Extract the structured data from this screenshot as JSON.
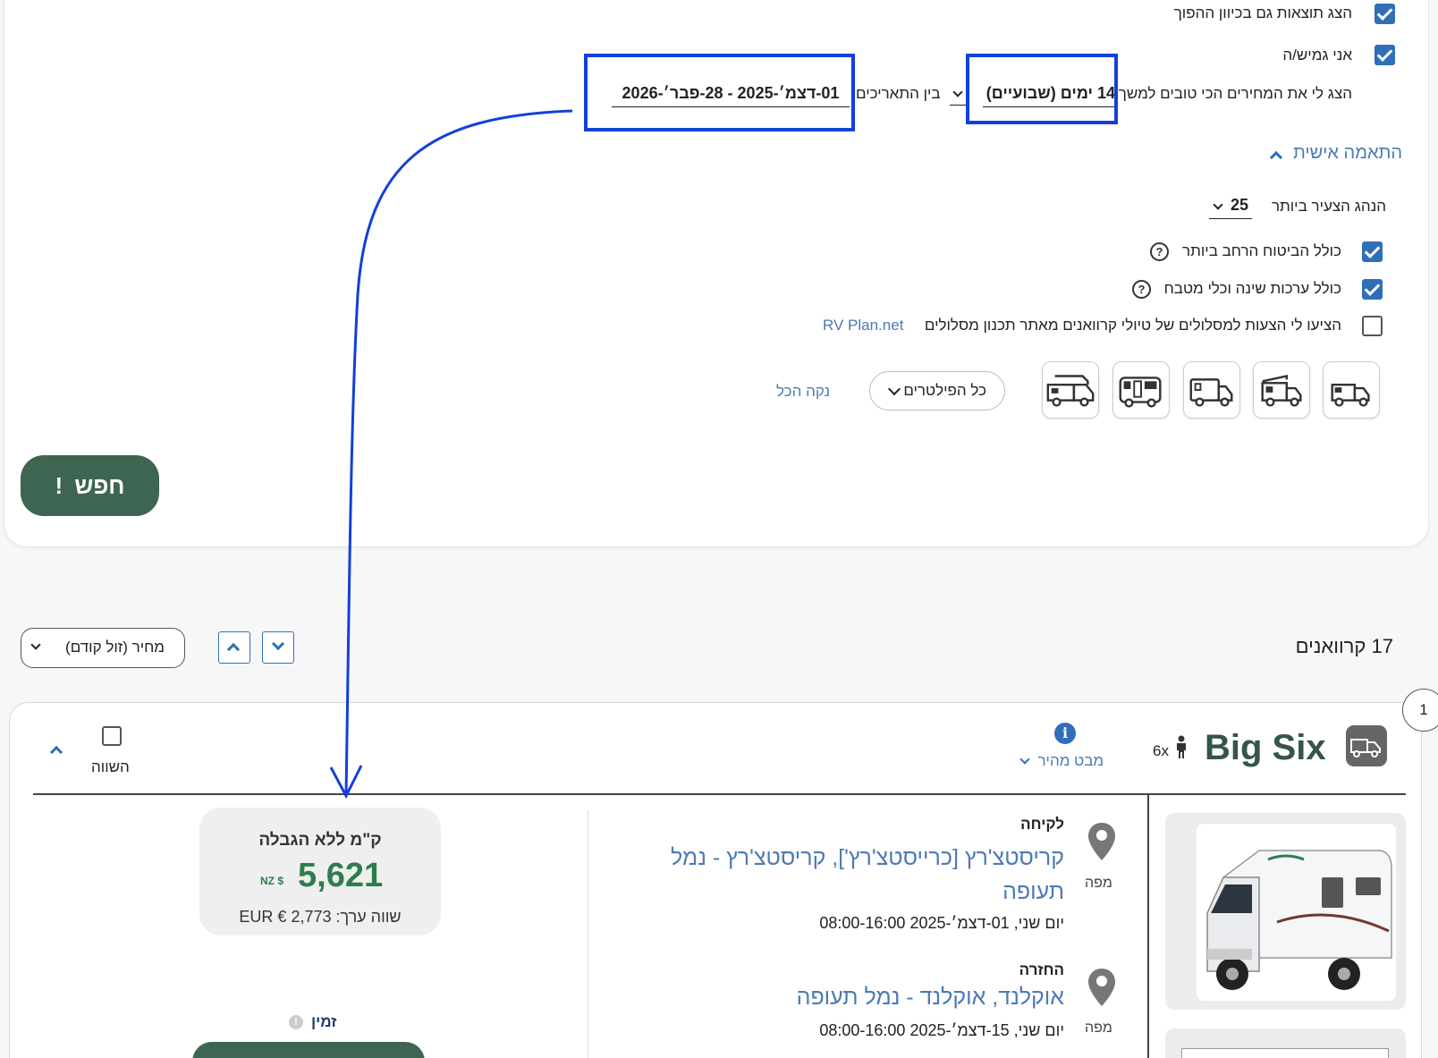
{
  "filters": {
    "reverse_results": "הצג תוצאות גם בכיוון ההפוך",
    "flexible": "אני גמיש/ה",
    "best_prices_prefix": "הצג לי את המחירים הכי טובים למשך",
    "duration_value": "14 ימים (שבועיים)",
    "between_dates_label": "בין התאריכים",
    "date_range_value": "01-דצמ׳-2025 - 28-פבר׳-2026",
    "custom_toggle": "התאמה אישית",
    "youngest_driver_label": "הנהג הצעיר ביותר",
    "youngest_driver_value": "25",
    "insurance_label": "כולל הביטוח הרחב ביותר",
    "bedding_label": "כולל ערכות שינה וכלי מטבח",
    "suggest_routes_label": "הציעו לי הצעות למסלולים של טיולי קרוואנים מאתר תכנון מסלולים",
    "rvplan_link": "RV Plan.net",
    "all_filters": "כל הפילטרים",
    "clear_all": "נקה הכל",
    "search_button": "חפש"
  },
  "results": {
    "count_label": "17 קרוואנים",
    "sort_value": "מחיר (זול קודם)"
  },
  "card": {
    "rank": "1",
    "name": "Big Six",
    "capacity": "6x",
    "quick_view": "מבט מהיר",
    "compare": "השווה",
    "pickup_label": "לקיחה",
    "pickup_location": "קריסטצ'רץ [כרייסטצ'רץ'], קריסטצ'רץ - נמל תעופה",
    "pickup_datetime": "יום שני, 01-דצמ׳-2025 08:00-16:00",
    "dropoff_label": "החזרה",
    "dropoff_location": "אוקלנד, אוקלנד - נמל תעופה",
    "dropoff_datetime": "יום שני, 15-דצמ׳-2025 08:00-16:00",
    "map_label": "מפה",
    "unlimited_km": "ק\"מ ללא הגבלה",
    "price": "5,621",
    "currency": "NZ $",
    "equiv_value": "שווה ערך: EUR € 2,773",
    "available": "זמין"
  },
  "colors": {
    "accent_blue": "#2f6fb7",
    "annotation_blue": "#1240d8",
    "price_green": "#2e7d4f",
    "button_green": "#3e6452"
  }
}
